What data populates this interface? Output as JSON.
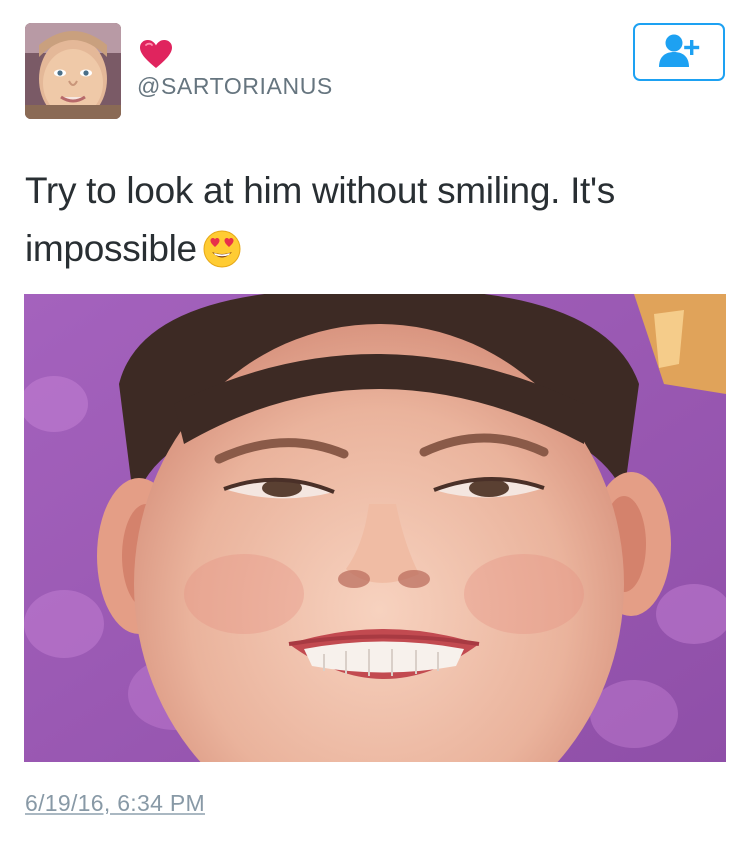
{
  "tweet": {
    "handle": "@SARTORIANUS",
    "text": "Try to look at him without smiling. It's impossible",
    "timestamp": "6/19/16, 6:34 PM",
    "reaction_icon": "heart-icon",
    "text_emoji": "smiling-face-with-heart-eyes-icon",
    "follow_icon": "add-user-icon"
  },
  "colors": {
    "accent": "#1da1f2",
    "heart": "#e0245e",
    "handle_text": "#66757f",
    "timestamp_text": "#8899a6",
    "body_text": "#292f33",
    "photo_background": "#9a58b2"
  }
}
